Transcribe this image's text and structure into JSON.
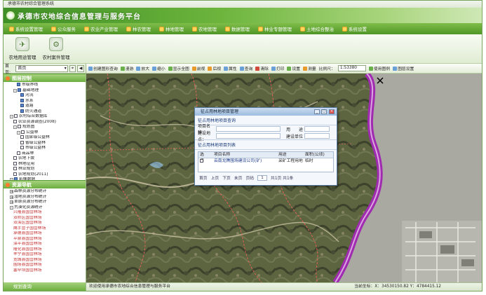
{
  "window": {
    "caption": "承德市农村综合管理系统"
  },
  "app": {
    "title": "承德市农地综合信息管理与服务平台"
  },
  "menu": [
    {
      "label": "系统设置管理",
      "icon": "settings-icon"
    },
    {
      "label": "公众服务",
      "icon": "people-icon"
    },
    {
      "label": "农业产业管理",
      "icon": "farm-icon"
    },
    {
      "label": "林农管理",
      "icon": "tree-icon"
    },
    {
      "label": "林地管理",
      "icon": "forest-icon"
    },
    {
      "label": "农地管理",
      "icon": "field-icon"
    },
    {
      "label": "数据管理",
      "icon": "database-icon"
    },
    {
      "label": "林业专题管理",
      "icon": "map-icon"
    },
    {
      "label": "土地综合整治",
      "icon": "land-icon"
    },
    {
      "label": "系统设置",
      "icon": "gear-icon"
    }
  ],
  "subbar": [
    {
      "label": "农地用途管理",
      "icon": "satellite-icon"
    },
    {
      "label": "农村案件管理",
      "icon": "document-icon"
    }
  ],
  "leftpanel": {
    "select_value": "首页",
    "layer_section": "图层控制",
    "layers": [
      {
        "text": "市级界线",
        "indent": 3,
        "checked": true,
        "exp": ""
      },
      {
        "text": "基础地理",
        "indent": 2,
        "checked": true,
        "exp": "-"
      },
      {
        "text": "河流",
        "indent": 4,
        "checked": true,
        "exp": ""
      },
      {
        "text": "水系",
        "indent": 4,
        "checked": true,
        "exp": ""
      },
      {
        "text": "道路",
        "indent": 4,
        "checked": true,
        "exp": ""
      },
      {
        "text": "防火通道",
        "indent": 4,
        "checked": true,
        "exp": ""
      },
      {
        "text": "农村综合数据库",
        "indent": 1,
        "checked": false,
        "exp": "-"
      },
      {
        "text": "农业资源调查(2008)",
        "indent": 2,
        "checked": false,
        "exp": ""
      },
      {
        "text": "规划图",
        "indent": 2,
        "checked": false,
        "exp": "-"
      },
      {
        "text": "公益林",
        "indent": 3,
        "checked": false,
        "exp": "-"
      },
      {
        "text": "国家级公益林",
        "indent": 4,
        "checked": false,
        "exp": ""
      },
      {
        "text": "省级公益林",
        "indent": 4,
        "checked": false,
        "exp": ""
      },
      {
        "text": "市级公益林",
        "indent": 4,
        "checked": false,
        "exp": ""
      },
      {
        "text": "商品林",
        "indent": 3,
        "checked": false,
        "exp": ""
      },
      {
        "text": "农地下拨",
        "indent": 2,
        "checked": false,
        "exp": ""
      },
      {
        "text": "林地征用",
        "indent": 2,
        "checked": false,
        "exp": ""
      },
      {
        "text": "林业规划",
        "indent": 2,
        "checked": false,
        "exp": ""
      },
      {
        "text": "农地规划(2011)",
        "indent": 2,
        "checked": false,
        "exp": ""
      },
      {
        "text": "影像数据",
        "indent": 1,
        "checked": true,
        "exp": "-"
      },
      {
        "text": "chengde_sh 0.5.img",
        "indent": 2,
        "checked": true,
        "exp": ""
      }
    ],
    "nav_section": "资源导航",
    "nav": [
      {
        "text": "森林资源分布统计",
        "indent": 1,
        "exp": "+",
        "red": false
      },
      {
        "text": "湿地资源分布统计",
        "indent": 1,
        "exp": "+",
        "red": false
      },
      {
        "text": "草原资源分布统计",
        "indent": 1,
        "exp": "+",
        "red": false
      },
      {
        "text": "荒漠化资源统计",
        "indent": 1,
        "exp": "-",
        "red": false
      },
      {
        "text": "兴隆县国营林场",
        "indent": 2,
        "exp": "",
        "red": true
      },
      {
        "text": "双桥区国营林场",
        "indent": 2,
        "exp": "",
        "red": true
      },
      {
        "text": "双滦区国营林场",
        "indent": 2,
        "exp": "",
        "red": true
      },
      {
        "text": "鹰手营子国营林场",
        "indent": 2,
        "exp": "",
        "red": true
      },
      {
        "text": "承德县国营林场",
        "indent": 2,
        "exp": "",
        "red": true
      },
      {
        "text": "平泉县国营林场",
        "indent": 2,
        "exp": "",
        "red": true
      },
      {
        "text": "滦平县国营林场",
        "indent": 2,
        "exp": "",
        "red": true
      },
      {
        "text": "隆化县国营林场",
        "indent": 2,
        "exp": "",
        "red": true
      },
      {
        "text": "丰宁县国营林场",
        "indent": 2,
        "exp": "",
        "red": true
      },
      {
        "text": "宽城县国营林场",
        "indent": 2,
        "exp": "",
        "red": true
      },
      {
        "text": "围场县国营林场",
        "indent": 2,
        "exp": "",
        "red": true
      },
      {
        "text": "塞罕坝国营林场",
        "indent": 2,
        "exp": "",
        "red": true
      }
    ],
    "bottom_section": "规划查询"
  },
  "toolbar": {
    "items": [
      {
        "label": "创建图形查询",
        "icon": "query-icon",
        "c": ""
      },
      {
        "label": "漫游",
        "icon": "pan-icon",
        "c": "g"
      },
      {
        "label": "放大",
        "icon": "zoom-in-icon",
        "c": ""
      },
      {
        "label": "缩小",
        "icon": "zoom-out-icon",
        "c": ""
      },
      {
        "label": "显示全图",
        "icon": "full-extent-icon",
        "c": "g"
      },
      {
        "label": "前视",
        "icon": "previous-view-icon",
        "c": "o"
      },
      {
        "label": "后视",
        "icon": "next-view-icon",
        "c": "o"
      },
      {
        "label": "属性",
        "icon": "info-icon",
        "c": ""
      },
      {
        "label": "查询",
        "icon": "search-icon",
        "c": ""
      },
      {
        "label": "清除",
        "icon": "clear-icon",
        "c": "r"
      },
      {
        "label": "打印",
        "icon": "print-icon",
        "c": ""
      },
      {
        "label": "设置",
        "icon": "settings-icon",
        "c": "g"
      },
      {
        "label": "测量",
        "icon": "measure-icon",
        "c": "o"
      }
    ],
    "scale_label": "比例尺：",
    "scale_value": "1:53380",
    "legend_label": "使用图例",
    "layer_setting_label": "图层设置"
  },
  "dialog": {
    "title": "征占用林地项目管理",
    "section1": "征占用林地项目查询",
    "project_name_label": "项目名称：",
    "use_label": "用　　途",
    "unit_label": "建设地点：",
    "build_unit_label": "建设单位",
    "section2": "征占用林地项目列表",
    "columns": [
      "选择",
      "项目名称",
      "用途",
      "面积(公顷)"
    ],
    "rows": [
      {
        "name": "云南龙腾围场建设公司(矿)",
        "use": "采矿工程用地",
        "area": "临时"
      }
    ],
    "pager": {
      "first": "首页",
      "prev": "上页",
      "next": "下页",
      "last": "末页",
      "page_label": "页码",
      "page_value": "1",
      "total": "共1页 共1条"
    }
  },
  "status": {
    "text": "欢迎使用承德市农地综合信息管理与服务平台",
    "coord": "当前坐标：X：34530150.82  Y：4784415.12"
  },
  "colors": {
    "accent": "#5a9e2f",
    "boundary": "#a02ab0"
  }
}
